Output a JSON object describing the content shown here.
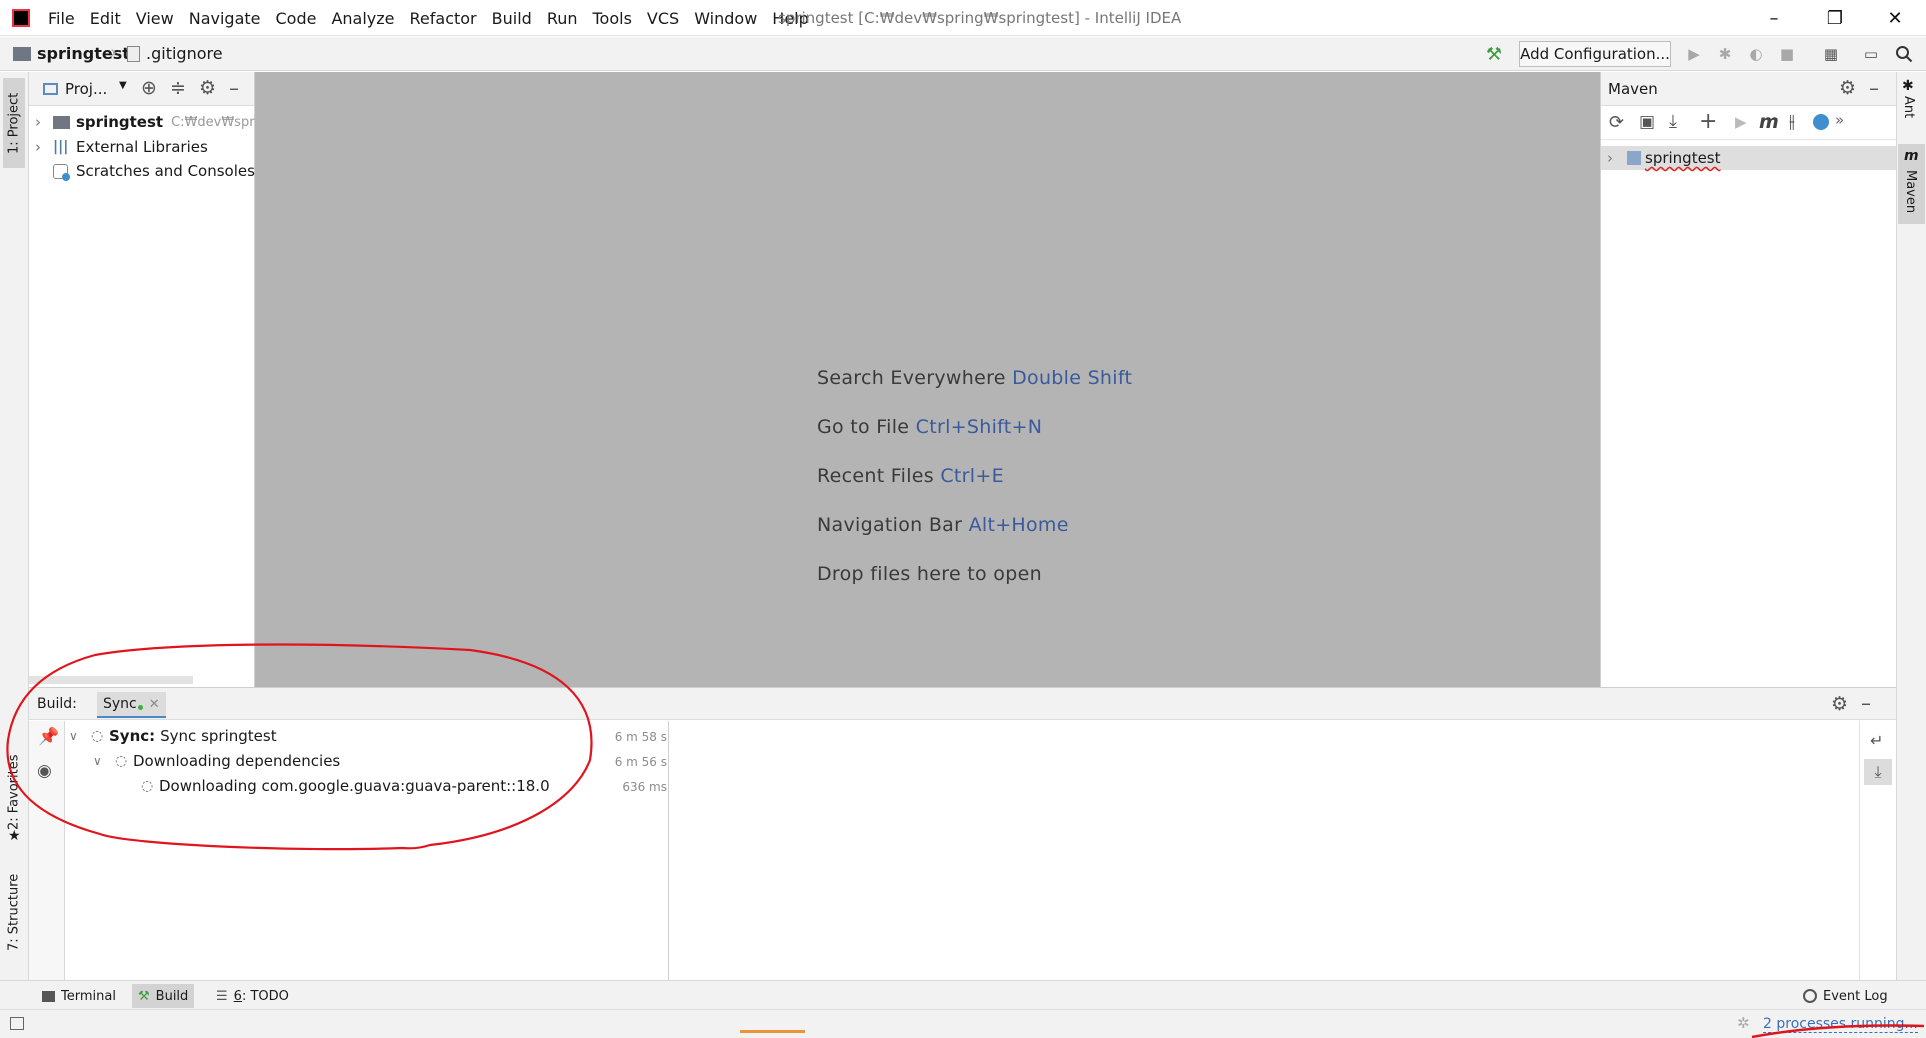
{
  "window": {
    "menu": [
      "File",
      "Edit",
      "View",
      "Navigate",
      "Code",
      "Analyze",
      "Refactor",
      "Build",
      "Run",
      "Tools",
      "VCS",
      "Window",
      "Help"
    ],
    "title": "springtest [C:₩dev₩spring₩springtest] - IntelliJ IDEA",
    "minimize": "–",
    "restore": "❐",
    "close": "✕"
  },
  "navbar": {
    "project": "springtest",
    "file": ".gitignore",
    "add_config": "Add Configuration..."
  },
  "left_stripe": {
    "project_tab": "1: Project",
    "favorites_tab": "2: Favorites",
    "structure_tab": "7: Structure"
  },
  "project_pane": {
    "title": "Proj...",
    "tree": [
      {
        "label": "springtest",
        "path": "C:₩dev₩spring"
      },
      {
        "label": "External Libraries"
      },
      {
        "label": "Scratches and Consoles"
      }
    ]
  },
  "editor": {
    "hints": [
      {
        "text": "Search Everywhere",
        "key": "Double Shift"
      },
      {
        "text": "Go to File",
        "key": "Ctrl+Shift+N"
      },
      {
        "text": "Recent Files",
        "key": "Ctrl+E"
      },
      {
        "text": "Navigation Bar",
        "key": "Alt+Home"
      },
      {
        "text": "Drop files here to open",
        "key": ""
      }
    ]
  },
  "maven": {
    "title": "Maven",
    "project": "springtest"
  },
  "right_stripe": {
    "ant_tab": "Ant",
    "maven_tab": "Maven"
  },
  "build": {
    "label": "Build:",
    "tab": "Sync",
    "rows": [
      {
        "prefix": "Sync:",
        "text": "Sync springtest",
        "time": "6 m 58 s"
      },
      {
        "prefix": "",
        "text": "Downloading dependencies",
        "time": "6 m 56 s"
      },
      {
        "prefix": "",
        "text": "Downloading com.google.guava:guava-parent::18.0",
        "time": "636 ms"
      }
    ]
  },
  "bottom_tabs": {
    "terminal": "Terminal",
    "build": "Build",
    "todo_num": "6",
    "todo": ": TODO",
    "event_log": "Event Log"
  },
  "status": {
    "processes": "2 processes running..."
  },
  "colors": {
    "editor_bg": "#b4b4b4",
    "shortcut": "#3a5a9c",
    "annotation": "#e0141c",
    "progress": "#e8943a"
  }
}
